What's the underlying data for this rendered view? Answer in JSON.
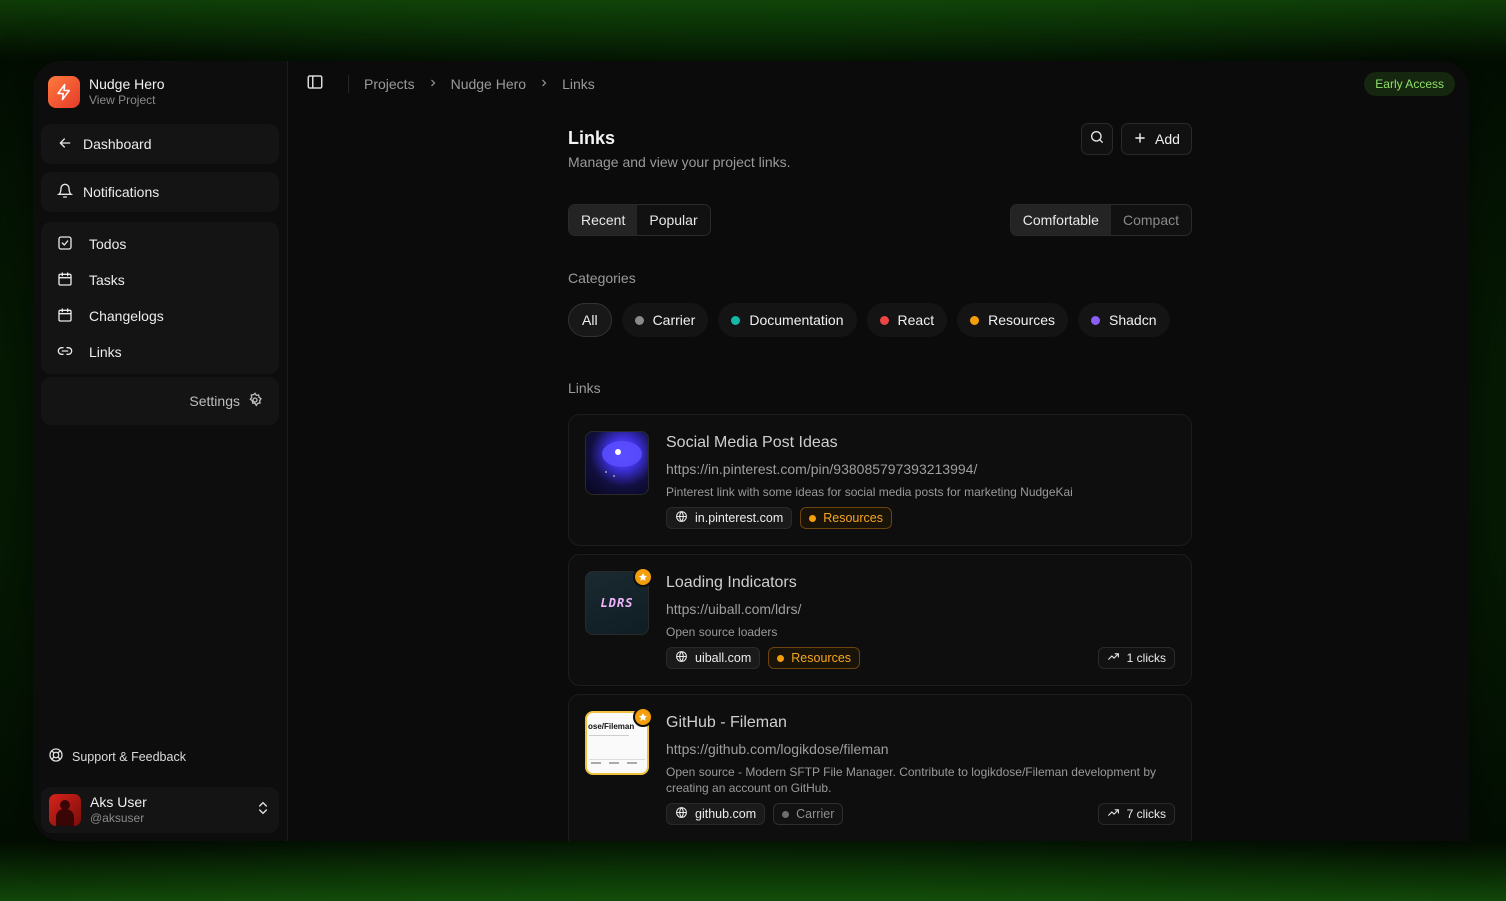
{
  "project": {
    "name": "Nudge Hero",
    "subtitle": "View Project"
  },
  "sidebar": {
    "dashboard": "Dashboard",
    "notifications": "Notifications",
    "items": [
      {
        "label": "Todos",
        "icon": "check-square-icon"
      },
      {
        "label": "Tasks",
        "icon": "calendar-icon"
      },
      {
        "label": "Changelogs",
        "icon": "calendar-icon"
      },
      {
        "label": "Links",
        "icon": "link-icon"
      }
    ],
    "settings": "Settings",
    "support": "Support & Feedback"
  },
  "user": {
    "name": "Aks User",
    "handle": "@aksuser"
  },
  "breadcrumb": [
    "Projects",
    "Nudge Hero",
    "Links"
  ],
  "badge": "Early Access",
  "header": {
    "title": "Links",
    "subtitle": "Manage and view your project links.",
    "add_label": "Add"
  },
  "sort_tabs": [
    {
      "label": "Recent",
      "active": true
    },
    {
      "label": "Popular",
      "active": false
    }
  ],
  "density_tabs": [
    {
      "label": "Comfortable",
      "active": true
    },
    {
      "label": "Compact",
      "active": false
    }
  ],
  "categories_label": "Categories",
  "categories": [
    {
      "label": "All",
      "color": ""
    },
    {
      "label": "Carrier",
      "color": "#8a8a8a"
    },
    {
      "label": "Documentation",
      "color": "#14b8a6"
    },
    {
      "label": "React",
      "color": "#ef4444"
    },
    {
      "label": "Resources",
      "color": "#f59e0b"
    },
    {
      "label": "Shadcn",
      "color": "#8b5cf6"
    }
  ],
  "links_label": "Links",
  "links": [
    {
      "title": "Social Media Post Ideas",
      "url": "https://in.pinterest.com/pin/938085797393213994/",
      "description": "Pinterest link with some ideas for social media posts for marketing NudgeKai",
      "domain": "in.pinterest.com",
      "category": "Resources",
      "category_color": "#f59e0b",
      "clicks": "",
      "starred": false
    },
    {
      "title": "Loading Indicators",
      "url": "https://uiball.com/ldrs/",
      "description": "Open source loaders",
      "domain": "uiball.com",
      "category": "Resources",
      "category_color": "#f59e0b",
      "clicks": "1 clicks",
      "starred": true,
      "thumb_text": "LDRS"
    },
    {
      "title": "GitHub - Fileman",
      "url": "https://github.com/logikdose/fileman",
      "description": "Open source - Modern SFTP File Manager. Contribute to logikdose/Fileman development by creating an account on GitHub.",
      "domain": "github.com",
      "category": "Carrier",
      "category_color": "#8a8a8a",
      "clicks": "7 clicks",
      "starred": true,
      "thumb_text": "ose/Fileman"
    }
  ],
  "colors": {
    "accent_green": "#8fe06a",
    "brand_orange": "#ff7a3d"
  }
}
